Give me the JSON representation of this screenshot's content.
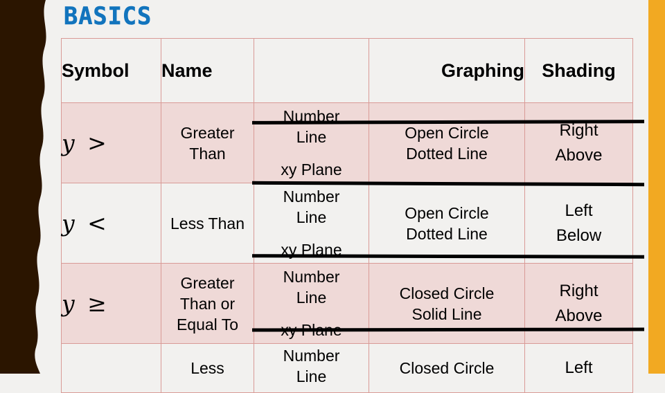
{
  "slide": {
    "title": "BASICS",
    "title_color": "#1274bd",
    "background_color": "#f2f1ef",
    "left_edge_color": "#2b1500",
    "right_edge_color": "#f2a922",
    "table_border_color": "#d99a96",
    "band_color": "#efd9d7",
    "rule_color": "#000000"
  },
  "table": {
    "headers": [
      {
        "label": "Symbol"
      },
      {
        "label": "Name"
      },
      {
        "label": ""
      },
      {
        "label": "Graphing"
      },
      {
        "label": "Shading"
      }
    ],
    "rows": [
      {
        "symbol_var": "y",
        "symbol_op": ">",
        "name": "Greater Than",
        "linetype_a": "Number",
        "linetype_a2": "Line",
        "linetype_b": "xy Plane",
        "graphing_a": "Open Circle",
        "graphing_b": "Dotted Line",
        "shading_a": "Right",
        "shading_b": "Above"
      },
      {
        "symbol_var": "y",
        "symbol_op": "<",
        "name": "Less Than",
        "linetype_a": "Number",
        "linetype_a2": "Line",
        "linetype_b": "xy Plane",
        "graphing_a": "Open Circle",
        "graphing_b": "Dotted Line",
        "shading_a": "Left",
        "shading_b": "Below"
      },
      {
        "symbol_var": "y",
        "symbol_op": "≥",
        "name": "Greater Than or Equal To",
        "linetype_a": "Number",
        "linetype_a2": "Line",
        "linetype_b": "xy Plane",
        "graphing_a": "Closed Circle",
        "graphing_b": "Solid Line",
        "shading_a": "Right",
        "shading_b": "Above"
      },
      {
        "symbol_var": "",
        "symbol_op": "",
        "name": "Less",
        "linetype_a": "Number",
        "linetype_a2": "Line",
        "linetype_b": "",
        "graphing_a": "Closed Circle",
        "graphing_b": "",
        "shading_a": "Left",
        "shading_b": ""
      }
    ]
  }
}
